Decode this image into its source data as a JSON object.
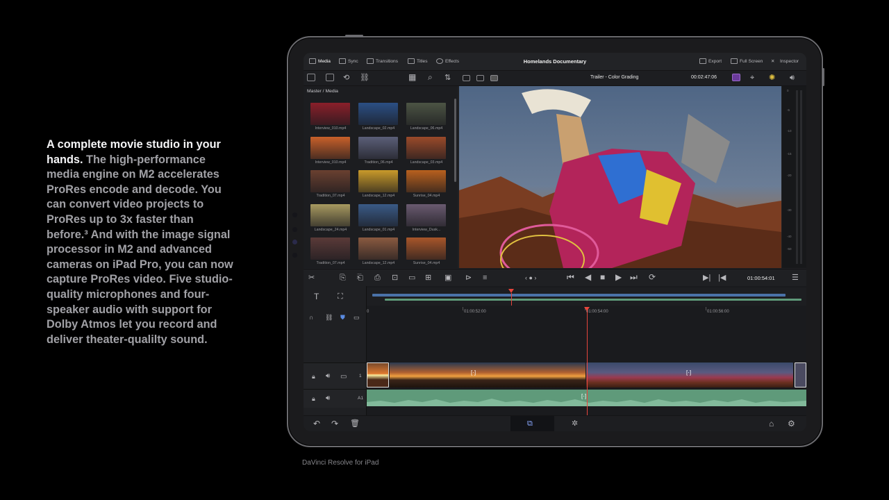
{
  "copy": {
    "lead": "A complete movie studio in your hands.",
    "body": " The high-performance media engine on M2 accelerates ProRes encode and decode. You can convert video projects to ProRes up to 3x faster than before.³ And with the image signal processor in M2 and advanced cameras on iPad Pro, you can now capture ProRes video. Five studio-quality microphones and four-speaker audio with support for Dolby Atmos let you record and deliver theater-qualilty sound."
  },
  "caption": "DaVinci Resolve for iPad",
  "app": {
    "tabs": [
      {
        "label": "Media",
        "icon": "media-icon"
      },
      {
        "label": "Sync",
        "icon": "sync-icon"
      },
      {
        "label": "Transitions",
        "icon": "transitions-icon"
      },
      {
        "label": "Titles",
        "icon": "titles-icon"
      },
      {
        "label": "Effects",
        "icon": "effects-icon"
      }
    ],
    "project_title": "Homelands Documentary",
    "right_actions": [
      {
        "label": "Export",
        "icon": "export-icon"
      },
      {
        "label": "Full Screen",
        "icon": "fullscreen-icon"
      },
      {
        "label": "Inspector",
        "icon": "inspector-icon"
      }
    ],
    "timeline_name": "Trailer - Color Grading",
    "source_timecode": "00:02:47:06",
    "media_path": "Master / Media",
    "media_clips": [
      {
        "label": "Interview_010.mp4",
        "color": "#8a1f2a"
      },
      {
        "label": "Landscape_02.mp4",
        "color": "#2b4f84"
      },
      {
        "label": "Landscape_06.mp4",
        "color": "#4c5444"
      },
      {
        "label": "Interview_010.mp4",
        "color": "#c8602a"
      },
      {
        "label": "Tradition_06.mp4",
        "color": "#5b5f78"
      },
      {
        "label": "Landscape_03.mp4",
        "color": "#9a4a2a"
      },
      {
        "label": "Tradition_07.mp4",
        "color": "#6a4030"
      },
      {
        "label": "Landscape_12.mp4",
        "color": "#c99a2a"
      },
      {
        "label": "Sunrise_04.mp4",
        "color": "#b8601e"
      },
      {
        "label": "Landscape_24.mp4",
        "color": "#a89a60"
      },
      {
        "label": "Landscape_01.mp4",
        "color": "#3a5a86"
      },
      {
        "label": "Interview_Dusk...",
        "color": "#6a5a70"
      },
      {
        "label": "Tradition_07.mp4",
        "color": "#5a3a38"
      },
      {
        "label": "Landscape_12.mp4",
        "color": "#8a5a40"
      },
      {
        "label": "Sunrise_04.mp4",
        "color": "#a8562a"
      }
    ],
    "meter_scale": [
      "0",
      "-5",
      "-10",
      "-15",
      "-20",
      "-30",
      "-40",
      "-50"
    ],
    "record_timecode": "01:00:54:01",
    "ruler_labels": [
      "0",
      "01:00:52:00",
      "01:00:54:00",
      "01:00:56:00"
    ],
    "video_track": {
      "number": "1"
    },
    "audio_track": {
      "number": "A1"
    },
    "colors": {
      "accent": "#e8453c",
      "audio_clip": "#5f9a7a",
      "overview_video": "#4a72a8",
      "overview_audio": "#5f9a7a"
    }
  }
}
